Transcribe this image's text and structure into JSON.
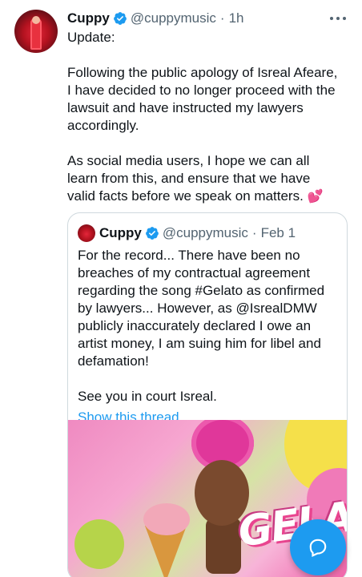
{
  "tweet": {
    "author_name": "Cuppy",
    "author_handle": "@cuppymusic",
    "separator": "·",
    "time": "1h",
    "paragraphs": [
      "Update:",
      "Following the public apology of Isreal Afeare, I have decided to no longer proceed with the lawsuit and have instructed my lawyers accordingly.",
      "As social media users, I hope we can all learn from this, and ensure that we have valid facts before we speak on matters."
    ],
    "emoji": "💕"
  },
  "quoted": {
    "author_name": "Cuppy",
    "author_handle": "@cuppymusic",
    "separator": "·",
    "time": "Feb 1",
    "paragraphs": [
      "For the record... There have been no breaches of my contractual agreement regarding the song #Gelato as confirmed by lawyers... However, as @IsrealDMW publicly inaccurately declared I owe an artist money, I am suing him for libel and defamation!",
      "See you in court Isreal."
    ],
    "show_thread": "Show this thread",
    "media_text": "GELATO"
  },
  "icons": {
    "verified": "verified-badge-icon",
    "more": "more-options-icon",
    "compose": "compose-reply-icon"
  },
  "colors": {
    "accent": "#1d9bf0",
    "secondary_text": "#536471",
    "border": "#cfd9de"
  }
}
